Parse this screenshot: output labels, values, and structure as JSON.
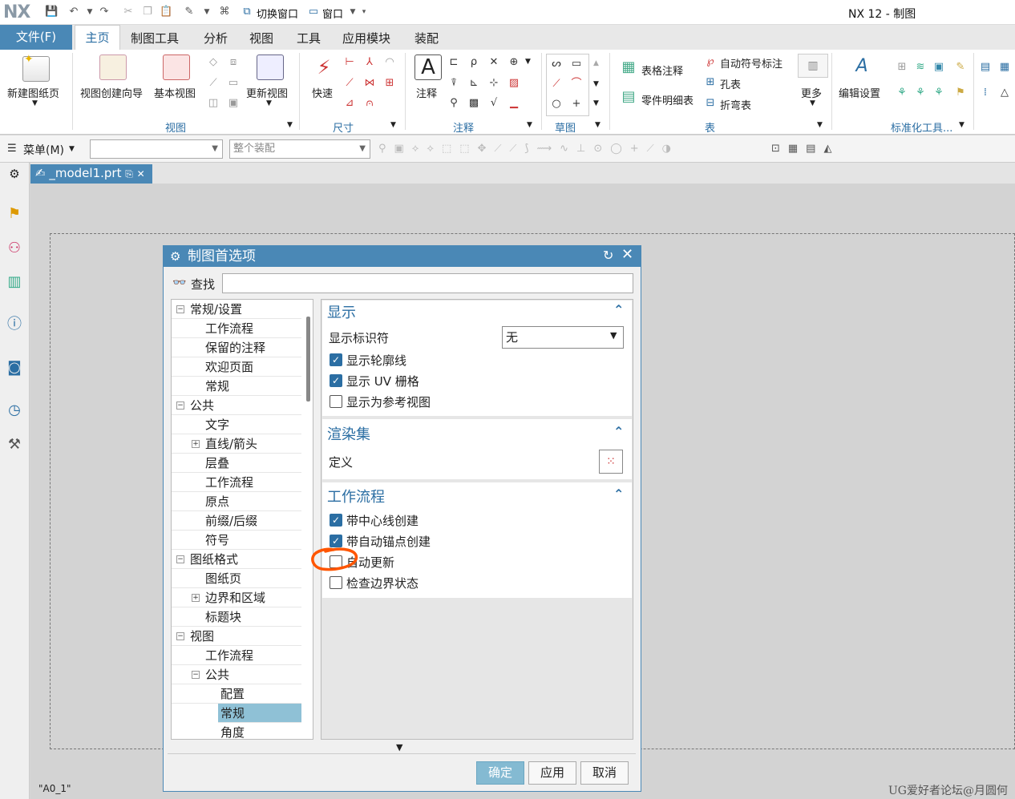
{
  "window": {
    "logo": "NX",
    "title": "NX 12 - 制图"
  },
  "quick_access": {
    "switch_window": "切换窗口",
    "window_menu": "窗口"
  },
  "ribbon": {
    "file_tab": "文件(F)",
    "tabs": [
      "主页",
      "制图工具",
      "分析",
      "视图",
      "工具",
      "应用模块",
      "装配"
    ],
    "buttons": {
      "new_sheet": "新建图纸页",
      "view_wizard": "视图创建向导",
      "base_view": "基本视图",
      "update_view": "更新视图",
      "quick": "快速",
      "note": "注释",
      "table_note": "表格注释",
      "parts_list": "零件明细表",
      "auto_balloon": "自动符号标注",
      "hole_table": "孔表",
      "bend_table": "折弯表",
      "more": "更多",
      "edit_settings": "编辑设置"
    },
    "groups": {
      "view": "视图",
      "dimension": "尺寸",
      "annotation": "注释",
      "sketch": "草图",
      "table": "表",
      "standardization": "标准化工具..."
    }
  },
  "toolbar2": {
    "menu": "菜单(M)",
    "combo1": "",
    "combo2": "整个装配"
  },
  "document": {
    "tab_label": "_model1.prt",
    "sheet_name": "\"A0_1\""
  },
  "watermark": "UG爱好者论坛@月圆何",
  "dialog": {
    "title": "制图首选项",
    "find_label": "查找",
    "find_value": "",
    "tree": [
      {
        "label": "常规/设置",
        "level": 0,
        "exp": "−"
      },
      {
        "label": "工作流程",
        "level": 1
      },
      {
        "label": "保留的注释",
        "level": 1
      },
      {
        "label": "欢迎页面",
        "level": 1
      },
      {
        "label": "常规",
        "level": 1
      },
      {
        "label": "公共",
        "level": 0,
        "exp": "−"
      },
      {
        "label": "文字",
        "level": 1
      },
      {
        "label": "直线/箭头",
        "level": 1,
        "exp": "+"
      },
      {
        "label": "层叠",
        "level": 1
      },
      {
        "label": "工作流程",
        "level": 1
      },
      {
        "label": "原点",
        "level": 1
      },
      {
        "label": "前缀/后缀",
        "level": 1
      },
      {
        "label": "符号",
        "level": 1
      },
      {
        "label": "图纸格式",
        "level": 0,
        "exp": "−"
      },
      {
        "label": "图纸页",
        "level": 1
      },
      {
        "label": "边界和区域",
        "level": 1,
        "exp": "+"
      },
      {
        "label": "标题块",
        "level": 1
      },
      {
        "label": "视图",
        "level": 0,
        "exp": "−"
      },
      {
        "label": "工作流程",
        "level": 1
      },
      {
        "label": "公共",
        "level": 1,
        "exp": "−"
      },
      {
        "label": "配置",
        "level": 2
      },
      {
        "label": "常规",
        "level": 2,
        "selected": true
      },
      {
        "label": "角度",
        "level": 2
      }
    ],
    "display": {
      "title": "显示",
      "indicator_label": "显示标识符",
      "indicator_value": "无",
      "show_silhouette": "显示轮廓线",
      "show_uv_grid": "显示 UV 栅格",
      "show_as_reference": "显示为参考视图"
    },
    "render_set": {
      "title": "渲染集",
      "define": "定义"
    },
    "workflow": {
      "title": "工作流程",
      "with_centerline": "带中心线创建",
      "with_anchor": "带自动锚点创建",
      "auto_update": "自动更新",
      "check_boundary": "检查边界状态"
    },
    "buttons": {
      "ok": "确定",
      "apply": "应用",
      "cancel": "取消"
    }
  },
  "colors": {
    "accent": "#4a88b6",
    "selected_row": "#8fc1d6",
    "annotation": "#ff5500"
  }
}
